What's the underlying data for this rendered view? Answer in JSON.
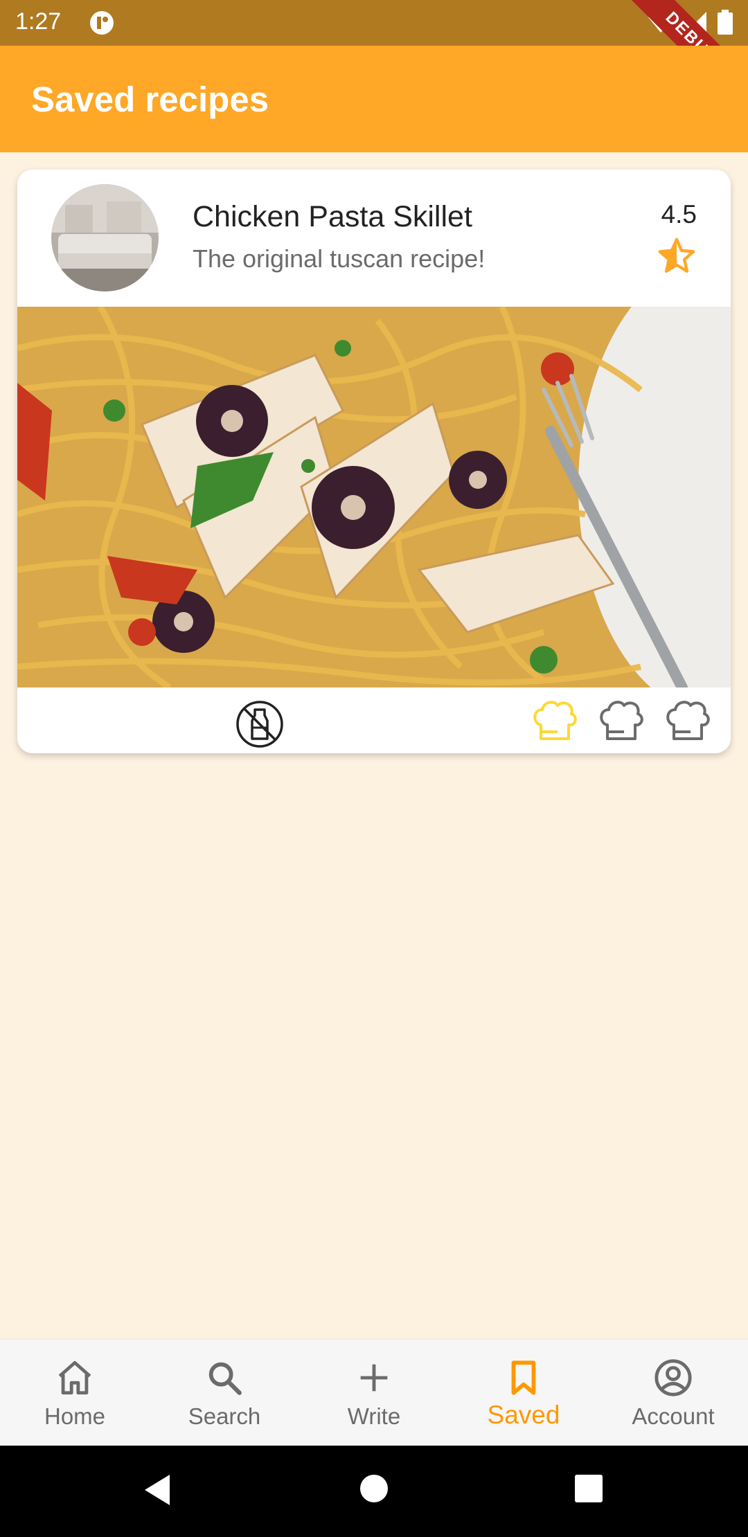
{
  "status_bar": {
    "time": "1:27",
    "debug_label": "DEBUG"
  },
  "app_bar": {
    "title": "Saved recipes"
  },
  "recipe_card": {
    "title": "Chicken Pasta Skillet",
    "subtitle": "The original tuscan recipe!",
    "rating": "4.5",
    "difficulty_level": 1,
    "difficulty_max": 3,
    "dietary_icon": "no-dairy-icon"
  },
  "bottom_nav": {
    "items": [
      {
        "label": "Home",
        "icon": "home-icon"
      },
      {
        "label": "Search",
        "icon": "search-icon"
      },
      {
        "label": "Write",
        "icon": "plus-icon"
      },
      {
        "label": "Saved",
        "icon": "bookmark-icon"
      },
      {
        "label": "Account",
        "icon": "account-icon"
      }
    ],
    "active": "Saved"
  },
  "colors": {
    "app_bar": "#FFA726",
    "status_bar": "#B07A21",
    "background": "#FDF1E0",
    "accent": "#FF9800",
    "difficulty_active": "#FDD835"
  }
}
